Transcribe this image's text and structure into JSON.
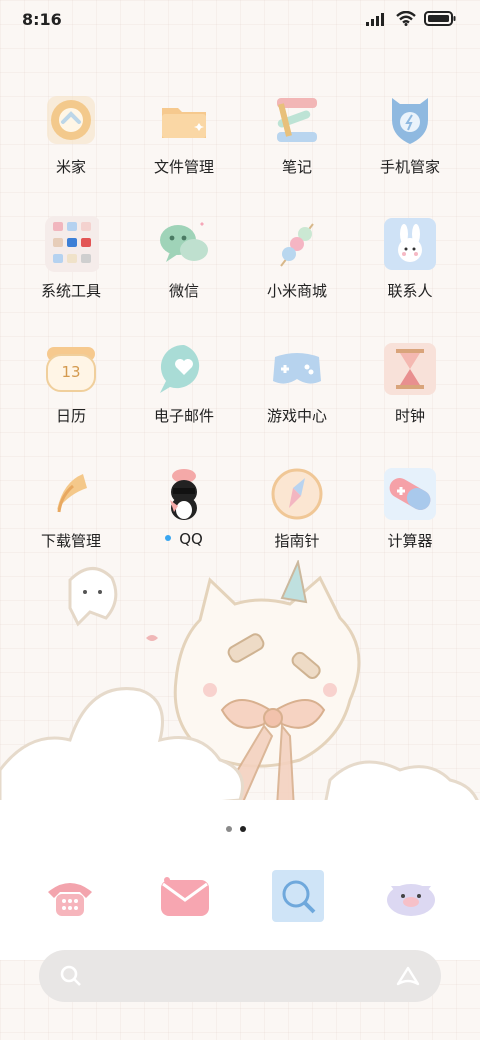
{
  "status_bar": {
    "time": "8:16",
    "icons": [
      "signal-icon",
      "wifi-icon",
      "battery-icon"
    ]
  },
  "apps": [
    {
      "label": "米家",
      "icon": "mijia-icon"
    },
    {
      "label": "文件管理",
      "icon": "folder-icon"
    },
    {
      "label": "笔记",
      "icon": "notes-icon"
    },
    {
      "label": "手机管家",
      "icon": "security-icon"
    },
    {
      "label": "系统工具",
      "icon": "tools-folder-icon"
    },
    {
      "label": "微信",
      "icon": "wechat-icon"
    },
    {
      "label": "小米商城",
      "icon": "store-icon"
    },
    {
      "label": "联系人",
      "icon": "contacts-icon"
    },
    {
      "label": "日历",
      "icon": "calendar-icon",
      "badge_text": "13"
    },
    {
      "label": "电子邮件",
      "icon": "email-icon"
    },
    {
      "label": "游戏中心",
      "icon": "game-icon"
    },
    {
      "label": "时钟",
      "icon": "clock-icon"
    },
    {
      "label": "下载管理",
      "icon": "download-icon"
    },
    {
      "label": "QQ",
      "icon": "qq-icon",
      "new_indicator": true
    },
    {
      "label": "指南针",
      "icon": "compass-icon"
    },
    {
      "label": "计算器",
      "icon": "calculator-icon"
    }
  ],
  "page_indicator": {
    "count": 2,
    "active": 2
  },
  "dock": [
    {
      "icon": "phone-icon"
    },
    {
      "icon": "messages-icon"
    },
    {
      "icon": "browser-icon"
    },
    {
      "icon": "camera-icon"
    }
  ],
  "search_bar": {
    "icons": [
      "search-icon",
      "assistant-icon"
    ]
  },
  "colors": {
    "background": "#fbf7f4",
    "accent_dot": "#3aa6f0"
  }
}
